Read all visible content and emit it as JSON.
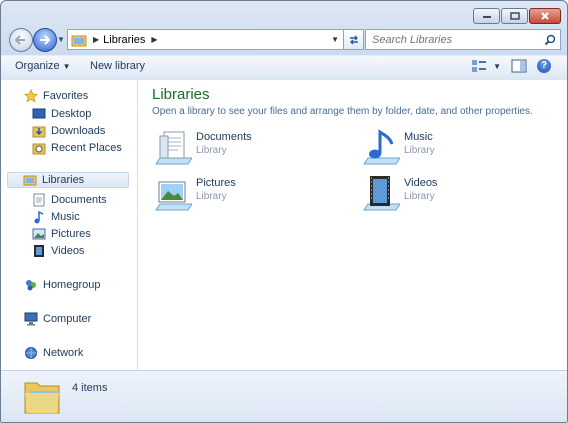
{
  "window": {
    "caption_buttons": [
      "minimize-icon",
      "maximize-icon",
      "close-icon"
    ]
  },
  "address": {
    "crumb": "Libraries",
    "search_placeholder": "Search Libraries"
  },
  "toolbar": {
    "organize": "Organize",
    "new_library": "New library"
  },
  "nav": {
    "favorites": "Favorites",
    "fav_items": [
      "Desktop",
      "Downloads",
      "Recent Places"
    ],
    "libraries": "Libraries",
    "lib_items": [
      "Documents",
      "Music",
      "Pictures",
      "Videos"
    ],
    "homegroup": "Homegroup",
    "computer": "Computer",
    "network": "Network"
  },
  "content": {
    "title": "Libraries",
    "description": "Open a library to see your files and arrange them by folder, date, and other properties.",
    "libraries": [
      {
        "name": "Documents",
        "type": "Library"
      },
      {
        "name": "Music",
        "type": "Library"
      },
      {
        "name": "Pictures",
        "type": "Library"
      },
      {
        "name": "Videos",
        "type": "Library"
      }
    ]
  },
  "status": {
    "count": "4 items"
  },
  "colors": {
    "accent_title": "#1d6a2e",
    "text": "#1e395b",
    "selection": "#dbe6f4"
  }
}
